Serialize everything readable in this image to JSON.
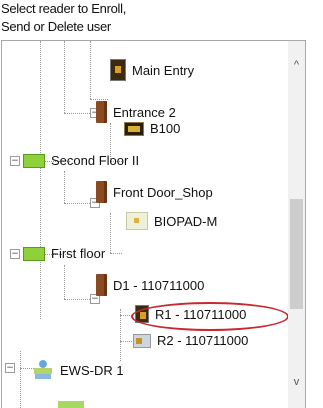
{
  "header": {
    "line1": "Select reader to Enroll,",
    "line2": "Send or Delete user"
  },
  "tree": {
    "nodes": [
      {
        "label": "Main Entry",
        "icon": "reader-icon"
      },
      {
        "label": "Entrance 2",
        "icon": "door-icon"
      },
      {
        "label": "B100",
        "icon": "reader-icon"
      },
      {
        "label": "Second Floor II",
        "icon": "floor-icon"
      },
      {
        "label": "Front Door_Shop",
        "icon": "door-icon"
      },
      {
        "label": "BIOPAD-M",
        "icon": "biometric-reader-icon"
      },
      {
        "label": "First floor",
        "icon": "floor-icon"
      },
      {
        "label": "D1 - 110711000",
        "icon": "door-icon"
      },
      {
        "label": "R1 - 110711000",
        "icon": "reader-icon",
        "highlighted": true
      },
      {
        "label": "R2 - 110711000",
        "icon": "reader-icon"
      },
      {
        "label": "EWS-DR 1",
        "icon": "controller-icon"
      }
    ],
    "expander_symbol": "−"
  },
  "scrollbar": {
    "up": "^",
    "down": "v"
  },
  "colors": {
    "highlight": "#c8282f",
    "floor": "#8fd13a",
    "door": "#8a4a22"
  }
}
